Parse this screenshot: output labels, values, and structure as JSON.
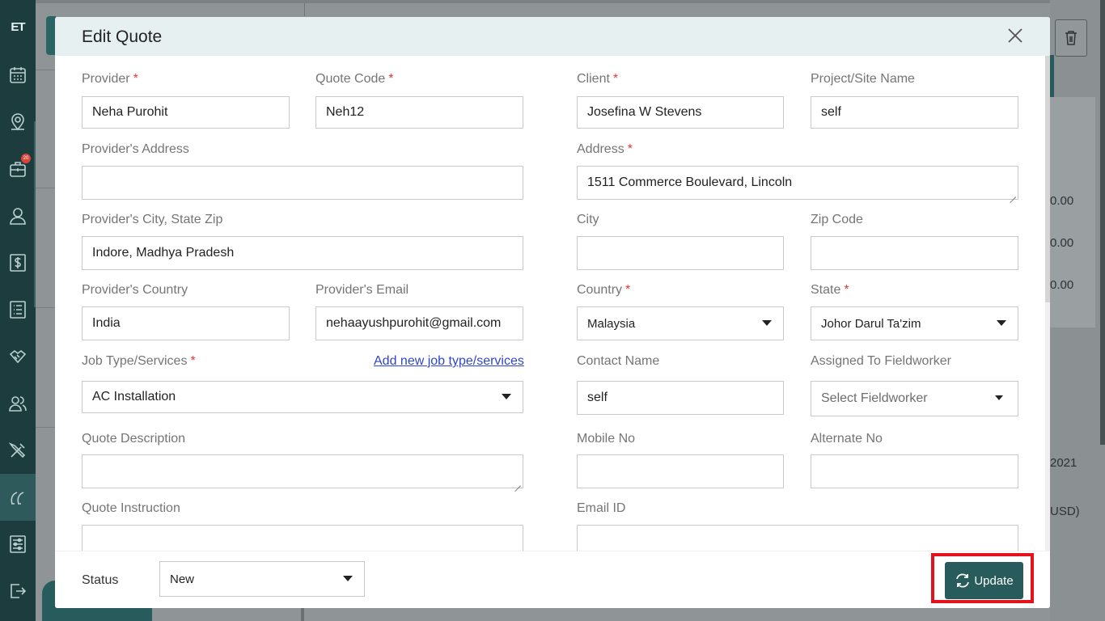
{
  "sidebar": {
    "logo": "ET",
    "badge_count": "20",
    "items": [
      {
        "icon": "calendar-icon"
      },
      {
        "icon": "map-pin-icon"
      },
      {
        "icon": "briefcase-icon"
      },
      {
        "icon": "user-icon"
      },
      {
        "icon": "dollar-icon"
      },
      {
        "icon": "list-icon"
      },
      {
        "icon": "handshake-icon"
      },
      {
        "icon": "users-icon"
      },
      {
        "icon": "tools-icon"
      },
      {
        "icon": "quote-icon"
      },
      {
        "icon": "settings-sliders-icon"
      },
      {
        "icon": "logout-icon"
      }
    ]
  },
  "background": {
    "values": [
      "0.00",
      "0.00",
      "0.00",
      "2021",
      "USD)"
    ]
  },
  "modal": {
    "title": "Edit Quote",
    "fields": {
      "provider": {
        "label": "Provider",
        "value": "Neha Purohit"
      },
      "quote_code": {
        "label": "Quote Code",
        "value": "Neh12"
      },
      "client": {
        "label": "Client",
        "value": "Josefina W Stevens"
      },
      "project_site": {
        "label": "Project/Site Name",
        "value": "self"
      },
      "provider_address": {
        "label": "Provider's Address",
        "value": ""
      },
      "address": {
        "label": "Address",
        "value": "1511  Commerce Boulevard, Lincoln"
      },
      "provider_city": {
        "label": "Provider's City, State Zip",
        "value": "Indore, Madhya Pradesh"
      },
      "city": {
        "label": "City",
        "value": ""
      },
      "zip": {
        "label": "Zip Code",
        "value": ""
      },
      "provider_country": {
        "label": "Provider's Country",
        "value": "India"
      },
      "provider_email": {
        "label": "Provider's Email",
        "value": "nehaayushpurohit@gmail.com"
      },
      "country": {
        "label": "Country",
        "value": "Malaysia"
      },
      "state": {
        "label": "State",
        "value": "Johor Darul Ta'zim"
      },
      "job_type": {
        "label": "Job Type/Services",
        "value": "AC Installation"
      },
      "add_job_link": "Add new job type/services",
      "contact_name": {
        "label": "Contact Name",
        "value": "self"
      },
      "fieldworker": {
        "label": "Assigned To Fieldworker",
        "placeholder": "Select Fieldworker"
      },
      "quote_description": {
        "label": "Quote Description",
        "value": ""
      },
      "mobile": {
        "label": "Mobile No",
        "value": ""
      },
      "alternate": {
        "label": "Alternate No",
        "value": ""
      },
      "quote_instruction": {
        "label": "Quote Instruction",
        "value": ""
      },
      "email_id": {
        "label": "Email ID",
        "value": ""
      }
    },
    "footer": {
      "status_label": "Status",
      "status_value": "New",
      "update_label": "Update"
    }
  },
  "colors": {
    "accent": "#285b5b",
    "required": "#e03a3a",
    "link": "#2f47c7",
    "highlight": "#e4131b"
  }
}
